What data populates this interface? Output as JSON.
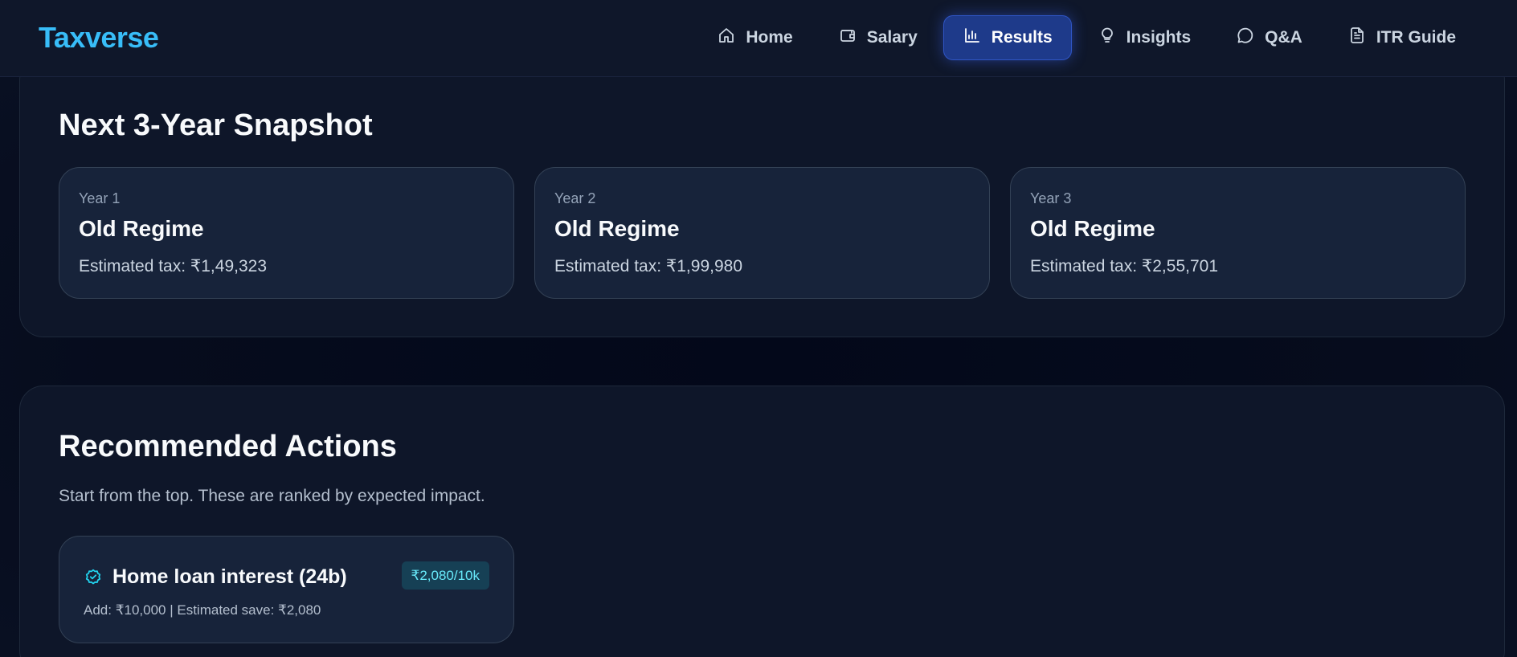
{
  "app": {
    "logo": "Taxverse"
  },
  "nav": {
    "items": [
      {
        "label": "Home",
        "icon": "home-icon"
      },
      {
        "label": "Salary",
        "icon": "wallet-icon"
      },
      {
        "label": "Results",
        "icon": "bar-chart-icon",
        "active": true
      },
      {
        "label": "Insights",
        "icon": "lightbulb-icon"
      },
      {
        "label": "Q&A",
        "icon": "chat-bubble-icon"
      },
      {
        "label": "ITR Guide",
        "icon": "document-icon"
      }
    ]
  },
  "snapshot": {
    "title": "Next 3-Year Snapshot",
    "years": [
      {
        "label": "Year 1",
        "regime": "Old Regime",
        "tax": "Estimated tax: ₹1,49,323"
      },
      {
        "label": "Year 2",
        "regime": "Old Regime",
        "tax": "Estimated tax: ₹1,99,980"
      },
      {
        "label": "Year 3",
        "regime": "Old Regime",
        "tax": "Estimated tax: ₹2,55,701"
      }
    ]
  },
  "actions": {
    "title": "Recommended Actions",
    "subtitle": "Start from the top. These are ranked by expected impact.",
    "items": [
      {
        "title": "Home loan interest (24b)",
        "badge": "₹2,080/10k",
        "detail": "Add: ₹10,000 | Estimated save: ₹2,080",
        "icon": "check-badge-icon"
      }
    ]
  },
  "colors": {
    "accent": "#38bdf8",
    "active_nav_bg": "#1e3a8a",
    "badge_bg": "#164055",
    "badge_text": "#67e8f9",
    "card_bg": "#17233a"
  }
}
